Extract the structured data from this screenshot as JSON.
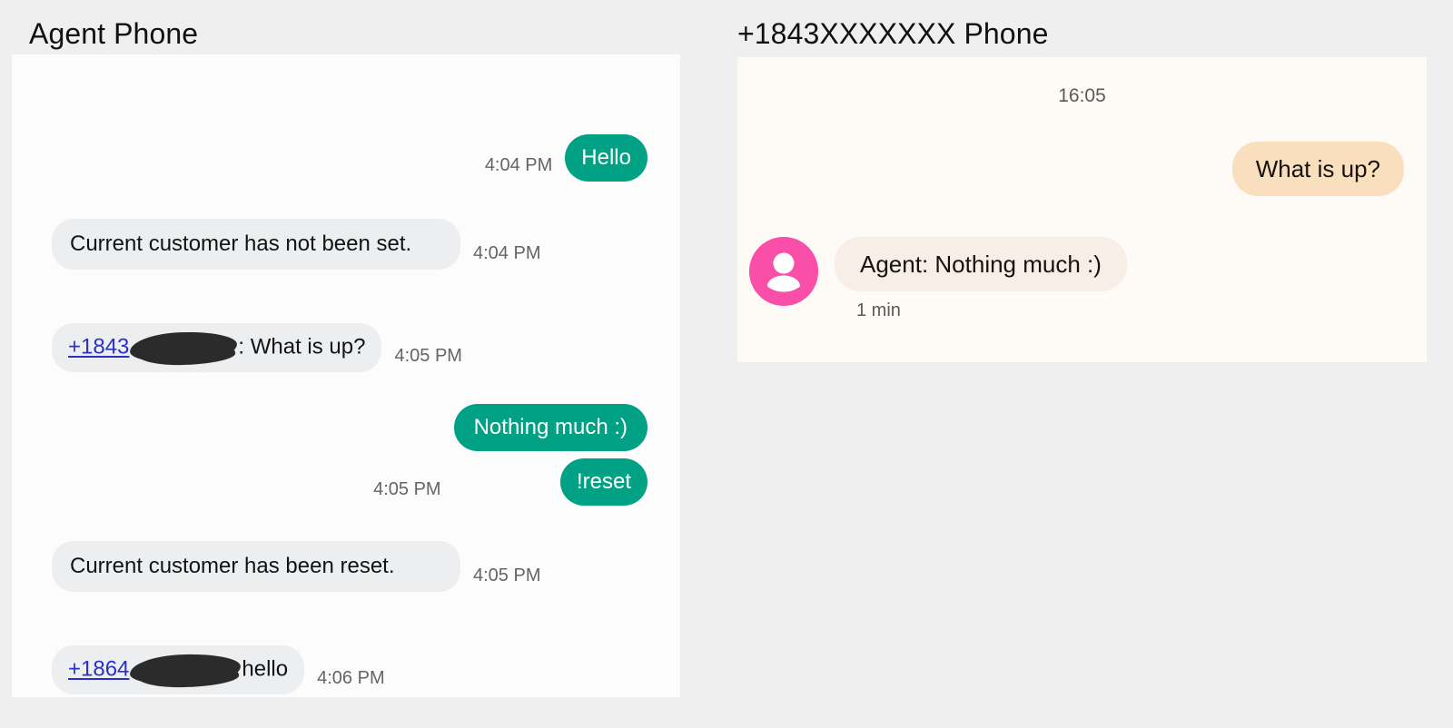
{
  "page": {
    "background_color": "#EFEFEF",
    "accent_outgoing_green": "#00A184",
    "accent_incoming_gray": "#ECEEF0",
    "accent_peach": "#FADFBF",
    "accent_cream": "#F6EEE7",
    "accent_avatar_pink": "#FA4FA8",
    "link_color": "#2A31C8"
  },
  "agent_phone": {
    "title": "Agent Phone",
    "messages": [
      {
        "id": "msg-hello",
        "direction": "outgoing",
        "text": "Hello",
        "timestamp": "4:04 PM"
      },
      {
        "id": "msg-customer-not-set",
        "direction": "incoming",
        "text": "Current customer has not been set.",
        "timestamp": "4:04 PM"
      },
      {
        "id": "msg-whatisup",
        "direction": "incoming",
        "link_text": "+1843",
        "redacted": true,
        "text": ": What is up?",
        "timestamp": "4:05 PM"
      },
      {
        "id": "msg-nothing-much",
        "direction": "outgoing",
        "text": "Nothing much :)",
        "grouped_with_next": true
      },
      {
        "id": "msg-reset",
        "direction": "outgoing",
        "text": "!reset",
        "timestamp": "4:05 PM"
      },
      {
        "id": "msg-customer-reset",
        "direction": "incoming",
        "text": "Current customer has been reset.",
        "timestamp": "4:05 PM"
      },
      {
        "id": "msg-hello-1864",
        "direction": "incoming",
        "link_text": "+1864",
        "redacted": true,
        "text": "hello",
        "timestamp": "4:06 PM"
      }
    ]
  },
  "client_phone": {
    "title": "+1843XXXXXXX Phone",
    "day_stamp": "16:05",
    "messages": [
      {
        "id": "msg-client-whatisup",
        "direction": "outgoing",
        "text": "What is up?"
      },
      {
        "id": "msg-client-agent-reply",
        "direction": "incoming",
        "avatar": "person-icon",
        "text": "Agent: Nothing much :)",
        "relative_time": "1 min"
      }
    ]
  }
}
